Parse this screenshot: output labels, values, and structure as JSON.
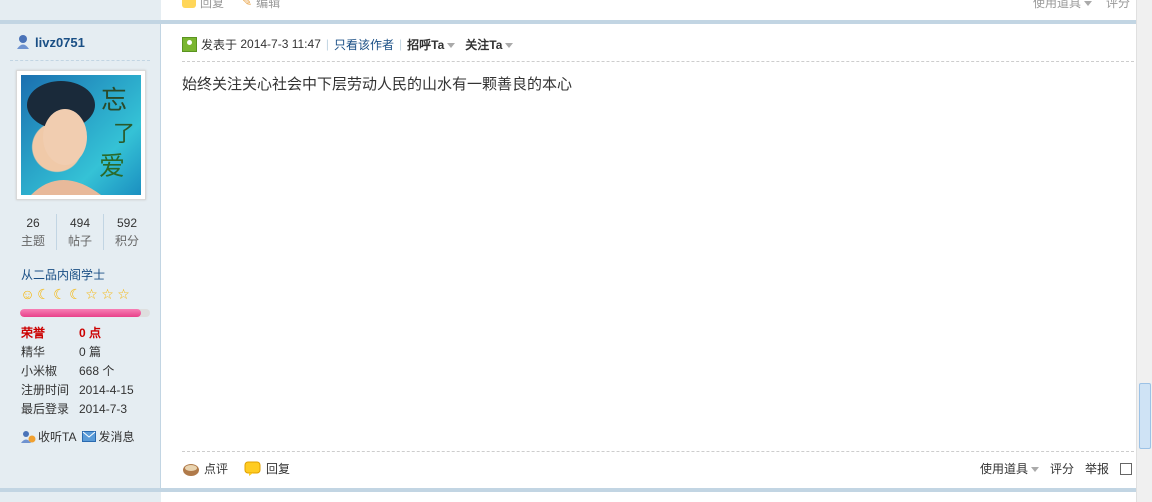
{
  "prev_post": {
    "reply": "回复",
    "edit": "编辑",
    "use_tool": "使用道具",
    "rate": "评分"
  },
  "user": {
    "name": "livz0751",
    "stats": [
      {
        "num": "26",
        "label": "主题"
      },
      {
        "num": "494",
        "label": "帖子"
      },
      {
        "num": "592",
        "label": "积分"
      }
    ],
    "rank": "从二品内阁学士",
    "star_icons": [
      "sun-icon",
      "moon-icon",
      "moon-icon",
      "moon-icon",
      "star-icon",
      "star-icon",
      "star-icon"
    ],
    "progress_fraction": 0.93,
    "info": [
      {
        "k": "荣誉",
        "v": "0 点",
        "highlight": true
      },
      {
        "k": "精华",
        "v": "0 篇"
      },
      {
        "k": "小米椒",
        "v": "668 个"
      },
      {
        "k": "注册时间",
        "v": "2014-4-15"
      },
      {
        "k": "最后登录",
        "v": "2014-7-3"
      }
    ],
    "follow_link": "收听TA",
    "message_link": "发消息"
  },
  "post": {
    "posted_prefix": "发表于",
    "posted_time": "2014-7-3 11:47",
    "only_author": "只看该作者",
    "greet": "招呼Ta",
    "follow": "关注Ta",
    "content": "始终关注关心社会中下层劳动人民的山水有一颗善良的本心",
    "comment": "点评",
    "reply": "回复",
    "use_tool": "使用道具",
    "rate": "评分",
    "report": "举报"
  },
  "colors": {
    "sidebar_bg": "#e5edf2",
    "separator": "#c2d5e3",
    "link": "#1a4f85",
    "honor_red": "#cc0000",
    "progress_pink": "#e8418a"
  }
}
